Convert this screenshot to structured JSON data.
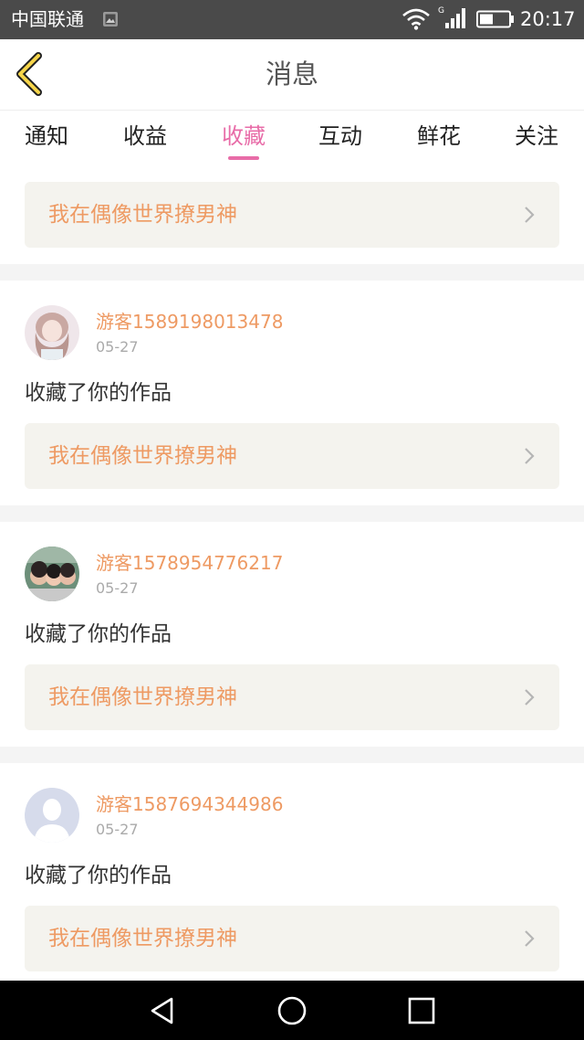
{
  "status_bar": {
    "carrier": "中国联通",
    "network": "G",
    "time": "20:17"
  },
  "header": {
    "title": "消息"
  },
  "tabs": [
    {
      "label": "通知",
      "active": false
    },
    {
      "label": "收益",
      "active": false
    },
    {
      "label": "收藏",
      "active": true
    },
    {
      "label": "互动",
      "active": false
    },
    {
      "label": "鲜花",
      "active": false
    },
    {
      "label": "关注",
      "active": false
    }
  ],
  "colors": {
    "accent": "#e86ca8",
    "orange_text": "#ee9a63",
    "card_bg": "#f4f3ee"
  },
  "items": [
    {
      "work_title": "我在偶像世界撩男神"
    },
    {
      "user_name": "游客1589198013478",
      "date": "05-27",
      "action": "收藏了你的作品",
      "work_title": "我在偶像世界撩男神"
    },
    {
      "user_name": "游客1578954776217",
      "date": "05-27",
      "action": "收藏了你的作品",
      "work_title": "我在偶像世界撩男神"
    },
    {
      "user_name": "游客1587694344986",
      "date": "05-27",
      "action": "收藏了你的作品",
      "work_title": "我在偶像世界撩男神"
    }
  ],
  "icons": {
    "back": "chevron-left-icon",
    "work_arrow": "chevron-right-icon",
    "nav_back": "triangle-back-icon",
    "nav_home": "circle-home-icon",
    "nav_recent": "square-recent-icon"
  }
}
